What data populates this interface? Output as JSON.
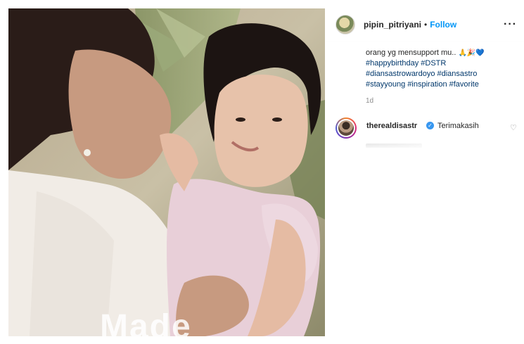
{
  "post": {
    "username": "pipin_pitriyani",
    "separator": "•",
    "follow_label": "Follow",
    "more_label": "···",
    "watermark": "Made"
  },
  "caption": {
    "line1": "orang yg mensupport mu..",
    "line1_emoji": "🙏🎉💙",
    "line2": "#happybirthday #DSTR",
    "line3": "#diansastrowardoyo #diansastro",
    "line4": "#stayyoung #inspiration #favorite"
  },
  "timestamp": "1d",
  "comment": {
    "username": "therealdisastr",
    "verified_mark": "✓",
    "text": "Terimakasih",
    "like_icon": "♡"
  },
  "colors": {
    "follow": "#0095f6",
    "hashtag": "#00376b",
    "verified": "#3897f0",
    "muted": "#8e8e8e"
  }
}
